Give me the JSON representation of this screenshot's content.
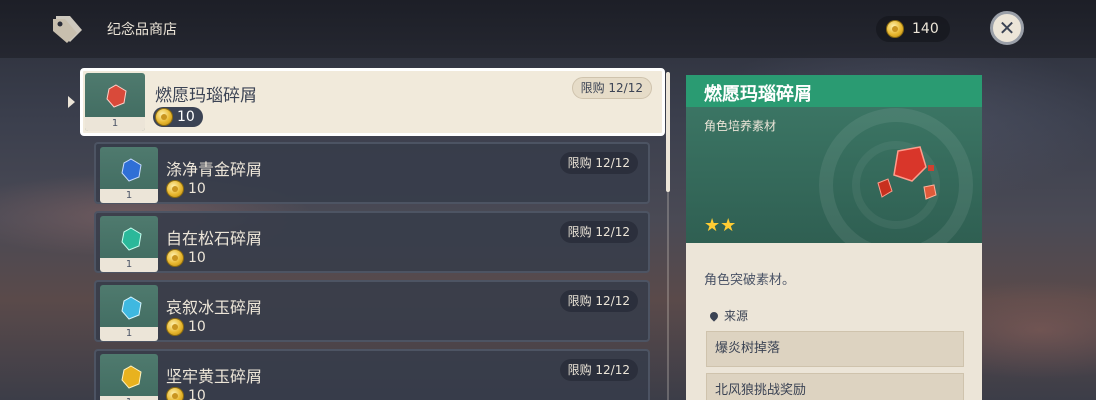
{
  "header": {
    "title": "纪念品商店",
    "currency_value": "140"
  },
  "items": [
    {
      "name": "燃愿玛瑙碎屑",
      "price": "10",
      "limit": "限购 12/12",
      "count": "1",
      "gem_color": "#d94a3a"
    },
    {
      "name": "涤净青金碎屑",
      "price": "10",
      "limit": "限购 12/12",
      "count": "1",
      "gem_color": "#2f6fd6"
    },
    {
      "name": "自在松石碎屑",
      "price": "10",
      "limit": "限购 12/12",
      "count": "1",
      "gem_color": "#2bb89a"
    },
    {
      "name": "哀叙冰玉碎屑",
      "price": "10",
      "limit": "限购 12/12",
      "count": "1",
      "gem_color": "#3fb8e0"
    },
    {
      "name": "坚牢黄玉碎屑",
      "price": "10",
      "limit": "限购 12/12",
      "count": "1",
      "gem_color": "#e8b21f"
    }
  ],
  "detail": {
    "title": "燃愿玛瑙碎屑",
    "type": "角色培养素材",
    "stars": "★★",
    "description": "角色突破素材。",
    "source_label": "来源",
    "sources": [
      "爆炎树掉落",
      "北风狼挑战奖励"
    ]
  }
}
